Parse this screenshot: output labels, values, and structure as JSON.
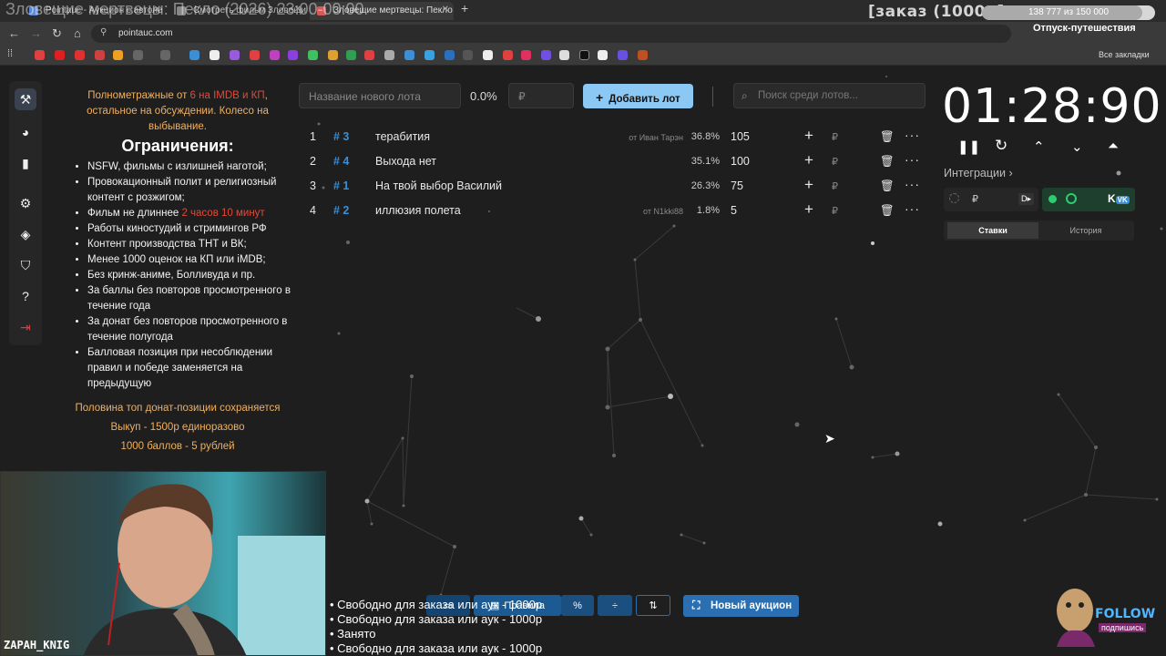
{
  "browser": {
    "tabs": [
      {
        "label": "Pointauc - Аукцион с автоле",
        "active": false
      },
      {
        "label": "Смотреть фильм Зловещие…",
        "active": false
      },
      {
        "label": "Зловещие мертвецы: Пекло (20…",
        "active": true
      }
    ],
    "new_tab": "+",
    "url": "pointauc.com",
    "bookmarks_label": "Все закладки"
  },
  "stream": {
    "title_overlay": "Зловещие мертвецы: Пекло (2026) 23:00-00:00",
    "order_label": "[заказ (1000р]",
    "progress_text": "138 777 из 150 000",
    "progress_fraction": 0.925,
    "event_label": "Отпуск-путешествия",
    "streamer_name": "ZAPAH_KNIG",
    "overlay_lines": [
      "• Свободно для заказа или аук - 1000р",
      "• Свободно для заказа или аук - 1000р",
      "• Занято",
      "• Свободно для заказа или аук - 1000р"
    ],
    "follow_text": "FOLLOW",
    "follow_sub": "подпишись"
  },
  "rules": {
    "intro_a": "Полнометражные от ",
    "intro_b": "6 на IMDB и КП",
    "intro_c": ", остальное на обсуждении. Колесо на выбывание.",
    "heading": "Ограничения:",
    "items": [
      "NSFW, фильмы с излишней наготой;",
      "Провокационный полит и религиозный контент с розжигом;",
      "Фильм не длиннее ",
      "Работы киностудий и стримингов РФ",
      "Контент производства ТНТ и ВК;",
      "Менее 1000 оценок на КП или iMDB;",
      "Без кринж-аниме, Болливуда и пр.",
      "За баллы без повторов просмотренного в течение года",
      "За донат без повторов просмотренного в течение полугода",
      "Балловая позиция при несоблюдении правил и победе заменяется на предыдущую"
    ],
    "duration_limit": "2 часов 10 минут",
    "footer": [
      "Половина топ донат-позиции сохраняется",
      "Выкуп - 1500р единоразово",
      "1000 баллов - 5 рублей"
    ]
  },
  "controls": {
    "lot_name_placeholder": "Название нового лота",
    "percent": "0.0%",
    "currency": "₽",
    "add_button": "Добавить лот",
    "search_placeholder": "Поиск среди лотов..."
  },
  "lots": [
    {
      "num": "1",
      "id": "# 3",
      "name": "терабития",
      "from": "от Иван Тарэн",
      "percent": "36.8%",
      "amount": "105"
    },
    {
      "num": "2",
      "id": "# 4",
      "name": "Выхода нет",
      "from": "",
      "percent": "35.1%",
      "amount": "100"
    },
    {
      "num": "3",
      "id": "# 1",
      "name": "На твой выбор Василий",
      "from": "",
      "percent": "26.3%",
      "amount": "75"
    },
    {
      "num": "4",
      "id": "# 2",
      "name": "иллюзия полета",
      "from": "от N1kki88",
      "percent": "1.8%",
      "amount": "5"
    }
  ],
  "timer": {
    "value": "01:28:90",
    "integrations_label": "Интеграции",
    "tab_bets": "Ставки",
    "tab_history": "История"
  },
  "bottom": {
    "rules_button": "Правила",
    "new_auction": "Новый аукцион"
  },
  "colors": {
    "accent": "#8cc8f4",
    "lot_id": "#3a8fd6",
    "orange": "#f0b060",
    "red": "#e04a3a"
  }
}
